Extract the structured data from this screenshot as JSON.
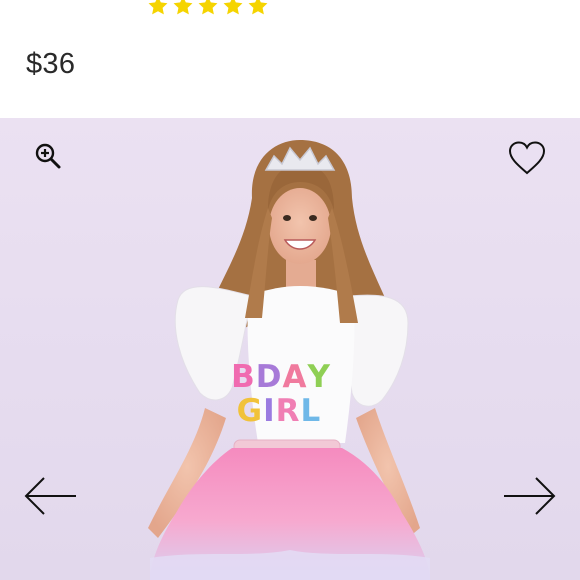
{
  "product": {
    "rating": {
      "stars": 5,
      "max": 5,
      "color": "#f5d400"
    },
    "price": "$36"
  },
  "gallery": {
    "background": "#e8def0",
    "zoom_icon": "zoom-in-icon",
    "favorite_icon": "heart-outline-icon",
    "prev_icon": "arrow-left-icon",
    "next_icon": "arrow-right-icon",
    "shirt_print": {
      "line1": [
        "B",
        "D",
        "A",
        "Y"
      ],
      "line2": [
        "G",
        "I",
        "R",
        "L"
      ],
      "colors_line1": [
        "#f06bb0",
        "#a77ad8",
        "#f07a9e",
        "#8fcf55"
      ],
      "colors_line2": [
        "#f1c23a",
        "#9a7be0",
        "#f07fb4",
        "#6fb8e8"
      ]
    }
  }
}
